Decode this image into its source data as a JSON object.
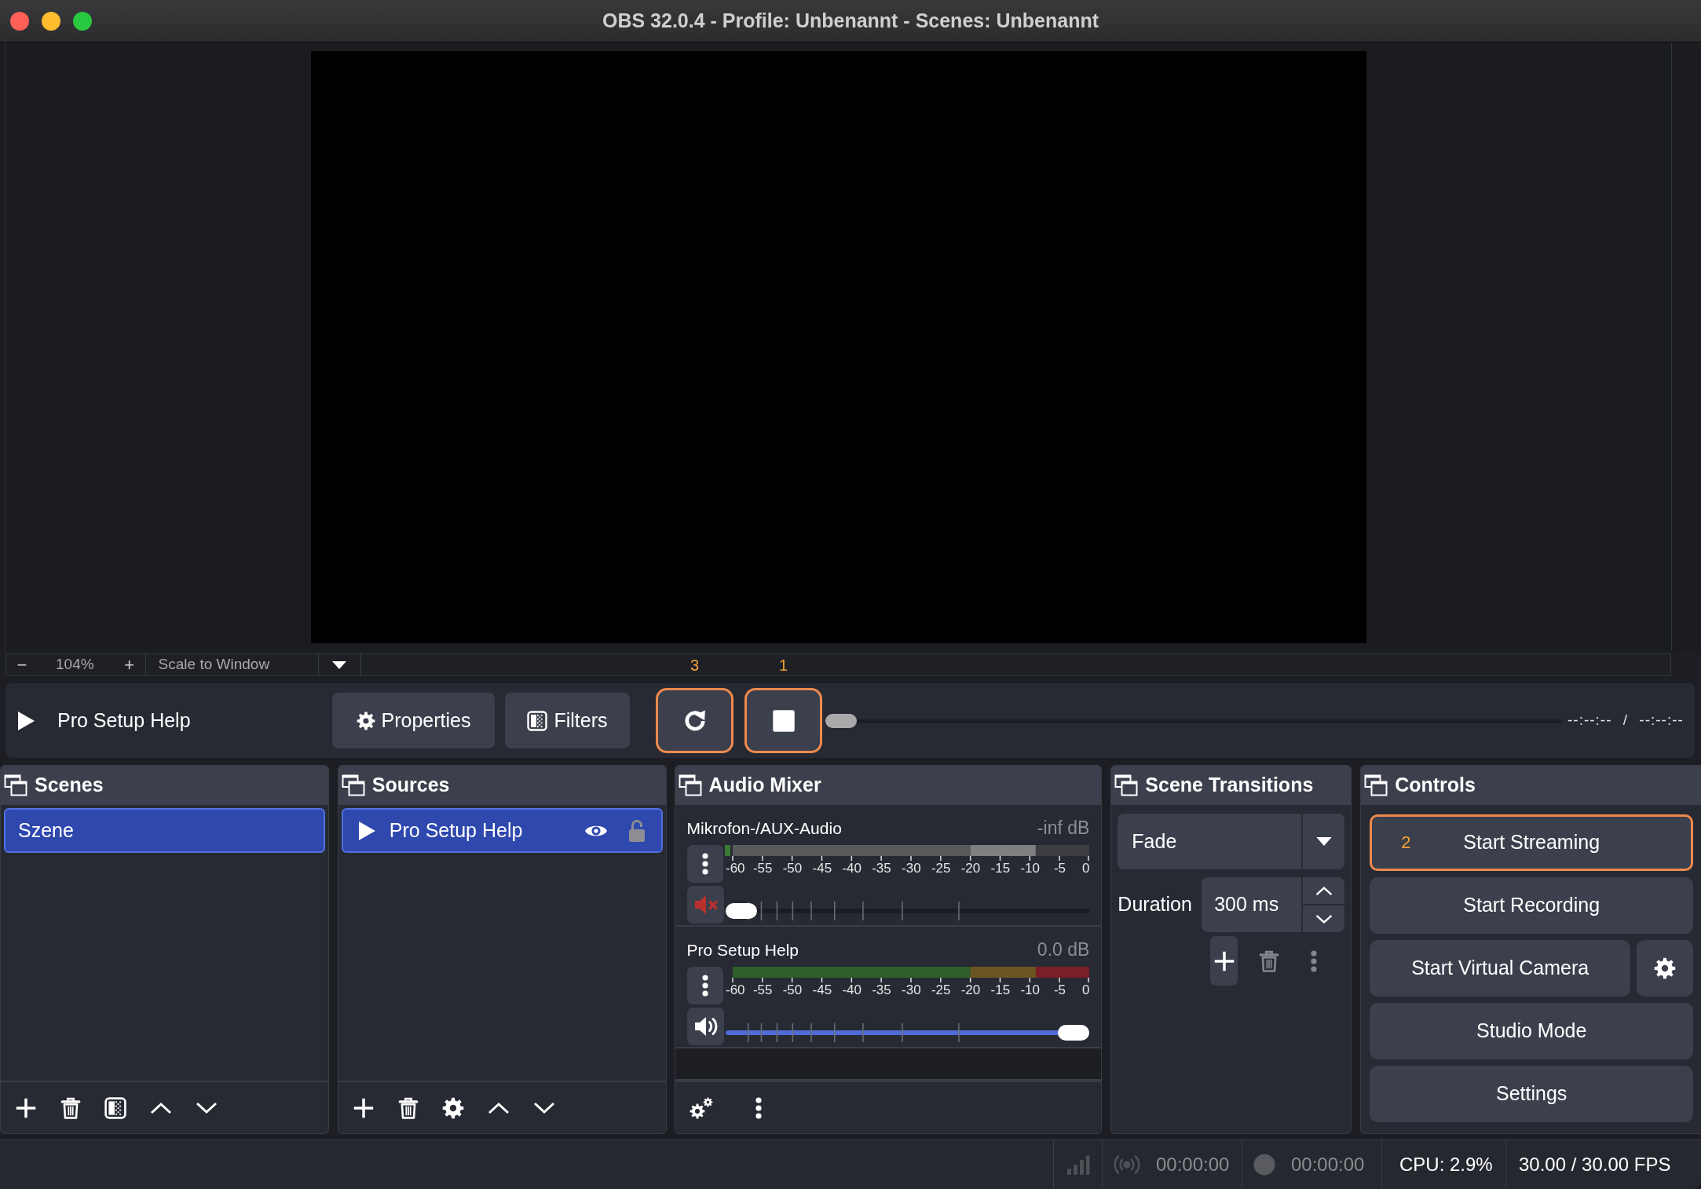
{
  "window": {
    "title": "OBS 32.0.4 - Profile: Unbenannt - Scenes: Unbenannt"
  },
  "preview_toolbar": {
    "zoom_out": "−",
    "zoom": "104%",
    "zoom_in": "+",
    "scale_mode": "Scale to Window"
  },
  "media_controls": {
    "source": "Pro Setup Help",
    "buttons": [
      {
        "kind": "properties",
        "label": "Properties"
      },
      {
        "kind": "filters",
        "label": "Filters"
      }
    ],
    "transport": [
      {
        "kind": "restart",
        "annotation": "3",
        "highlighted": true
      },
      {
        "kind": "stop",
        "annotation": "1",
        "highlighted": true
      }
    ],
    "seek": {
      "level": 0
    },
    "time": "--:--:-- / --:--:--"
  },
  "scenes": {
    "title": "Scenes",
    "items": [
      {
        "label": "Szene",
        "selected": true
      }
    ]
  },
  "sources": {
    "title": "Sources",
    "items": [
      {
        "label": "Pro Setup Help",
        "selected": true,
        "visible": true,
        "locked": false
      }
    ]
  },
  "audio_mixer": {
    "title": "Audio Mixer",
    "channels": [
      {
        "name": "Mikrofon-/AUX-Audio",
        "reading": "-inf dB",
        "muted": true,
        "peak": true,
        "level": 0,
        "scale": [
          "-60",
          "-55",
          "-50",
          "-45",
          "-40",
          "-35",
          "-30",
          "-25",
          "-20",
          "-15",
          "-10",
          "-5",
          "0"
        ]
      },
      {
        "name": "Pro Setup Help",
        "reading": "0.0 dB",
        "muted": false,
        "peak": false,
        "level": 1,
        "scale": [
          "-60",
          "-55",
          "-50",
          "-45",
          "-40",
          "-35",
          "-30",
          "-25",
          "-20",
          "-15",
          "-10",
          "-5",
          "0"
        ]
      }
    ]
  },
  "scene_transitions": {
    "title": "Scene Transitions",
    "transition": "Fade",
    "duration_label": "Duration",
    "duration": "300 ms",
    "actions": [
      {
        "kind": "add",
        "disabled": false
      },
      {
        "kind": "remove",
        "disabled": true
      },
      {
        "kind": "menu",
        "disabled": true
      }
    ]
  },
  "controls": {
    "title": "Controls",
    "buttons": [
      {
        "kind": "plain",
        "label": "Start Streaming",
        "annotation": "2",
        "highlighted": true
      },
      {
        "kind": "plain",
        "label": "Start Recording",
        "highlighted": false
      },
      {
        "kind": "split",
        "label": "Start Virtual Camera",
        "highlighted": false
      },
      {
        "kind": "plain",
        "label": "Studio Mode",
        "highlighted": false
      },
      {
        "kind": "plain",
        "label": "Settings",
        "highlighted": false
      }
    ]
  },
  "status_bar": {
    "streaming": false,
    "stream_time": "00:00:00",
    "recording": false,
    "record_time": "00:00:00",
    "cpu": "CPU: 2.9%",
    "fps": "30.00 / 30.00 FPS"
  }
}
